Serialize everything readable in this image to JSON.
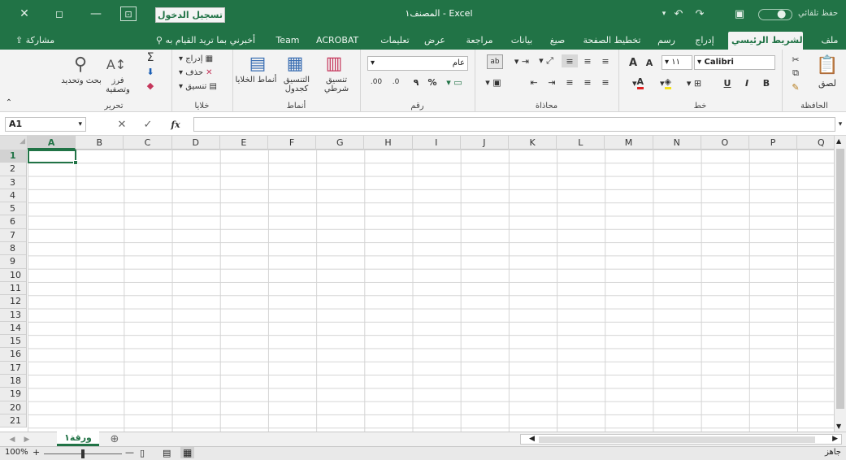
{
  "titlebar": {
    "signin": "تسجيل الدخول",
    "doc_title": "المصنف١ - Excel",
    "autosave": "حفظ تلقائي",
    "autosave_state": "●"
  },
  "tabs": [
    {
      "label": "ملف"
    },
    {
      "label": "الشريط الرئيسي"
    },
    {
      "label": "إدراج"
    },
    {
      "label": "رسم"
    },
    {
      "label": "تخطيط الصفحة"
    },
    {
      "label": "صيغ"
    },
    {
      "label": "بيانات"
    },
    {
      "label": "مراجعة"
    },
    {
      "label": "عرض"
    },
    {
      "label": "تعليمات"
    },
    {
      "label": "ACROBAT"
    },
    {
      "label": "Team"
    },
    {
      "label": "أخبرني بما تريد القيام به"
    },
    {
      "label": "مشاركة"
    }
  ],
  "ribbon": {
    "clipboard": {
      "label": "الحافظة",
      "paste": "لصق"
    },
    "font": {
      "label": "خط",
      "font_name": "Calibri",
      "font_size": "١١",
      "bold": "B",
      "italic": "I",
      "underline": "U",
      "grow": "A",
      "shrink": "A"
    },
    "alignment": {
      "label": "محاذاة"
    },
    "number": {
      "label": "رقم",
      "format": "عام",
      "percent": "%",
      "comma": "٩",
      "inc": ".00",
      "dec": ".0"
    },
    "styles": {
      "label": "أنماط",
      "conditional": "تنسيق شرطي",
      "as_table": "التنسيق كجدول",
      "cell_styles": "أنماط الخلايا"
    },
    "cells": {
      "label": "خلايا",
      "insert": "إدراج",
      "delete": "حذف",
      "format": "تنسيق"
    },
    "editing": {
      "label": "تحرير",
      "sort": "فرز وتصفية",
      "find": "بحث وتحديد",
      "sum": "Σ"
    }
  },
  "formula": {
    "namebox": "A1",
    "fx": "fx",
    "cancel": "✕",
    "enter": "✓",
    "value": ""
  },
  "columns": [
    "A",
    "B",
    "C",
    "D",
    "E",
    "F",
    "G",
    "H",
    "I",
    "J",
    "K",
    "L",
    "M",
    "N",
    "O",
    "P",
    "Q"
  ],
  "rows": [
    "1",
    "2",
    "3",
    "4",
    "5",
    "6",
    "7",
    "8",
    "9",
    "10",
    "11",
    "12",
    "13",
    "14",
    "15",
    "16",
    "17",
    "18",
    "19",
    "20",
    "21"
  ],
  "sheet": {
    "name": "ورقة١",
    "add": "⊕"
  },
  "status": {
    "zoom": "100%",
    "ready": "جاهز"
  }
}
